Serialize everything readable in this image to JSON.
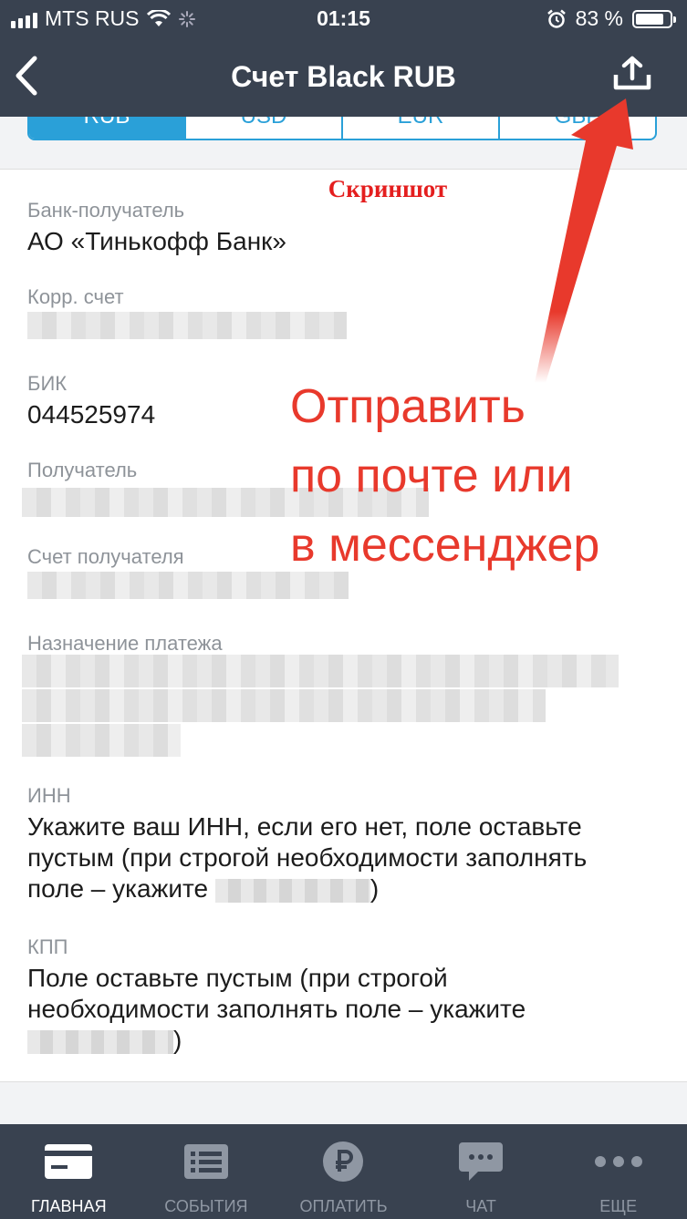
{
  "status_bar": {
    "carrier": "MTS RUS",
    "time": "01:15",
    "battery": "83 %",
    "battery_level": 0.83
  },
  "header": {
    "title": "Счет Black RUB"
  },
  "currency_tabs": [
    {
      "label": "RUB",
      "active": true
    },
    {
      "label": "USD",
      "active": false
    },
    {
      "label": "EUR",
      "active": false
    },
    {
      "label": "GBP",
      "active": false
    }
  ],
  "annotations": {
    "screenshot_label": "Скриншот",
    "share_hint_line1": "Отправить",
    "share_hint_line2": "по почте или",
    "share_hint_line3": "в мессенджер"
  },
  "fields": {
    "bank": {
      "label": "Банк-получатель",
      "value": "АО «Тинькофф Банк»"
    },
    "corr": {
      "label": "Корр. счет"
    },
    "bik": {
      "label": "БИК",
      "value": "044525974"
    },
    "recipient": {
      "label": "Получатель"
    },
    "recipient_account": {
      "label": "Счет получателя"
    },
    "purpose": {
      "label": "Назначение платежа"
    },
    "inn": {
      "label": "ИНН",
      "value_line1": "Укажите ваш ИНН, если его нет, поле оставьте",
      "value_line2": "пустым (при строгой необходимости заполнять",
      "value_line3_prefix": "поле – укажите ",
      "value_line3_suffix": ")"
    },
    "kpp": {
      "label": "КПП",
      "value_line1": "Поле оставьте пустым (при строгой",
      "value_line2": "необходимости заполнять поле – укажите",
      "value_line3_suffix": ")"
    }
  },
  "tabbar": [
    {
      "label": "ГЛАВНАЯ",
      "icon": "card-icon",
      "active": true
    },
    {
      "label": "СОБЫТИЯ",
      "icon": "list-icon",
      "active": false
    },
    {
      "label": "ОПЛАТИТЬ",
      "icon": "ruble-icon",
      "active": false
    },
    {
      "label": "ЧАТ",
      "icon": "chat-icon",
      "active": false
    },
    {
      "label": "ЕЩЕ",
      "icon": "more-icon",
      "active": false
    }
  ],
  "colors": {
    "header_bg": "#394250",
    "accent": "#2aa0d8",
    "annotation": "#e8392c"
  }
}
